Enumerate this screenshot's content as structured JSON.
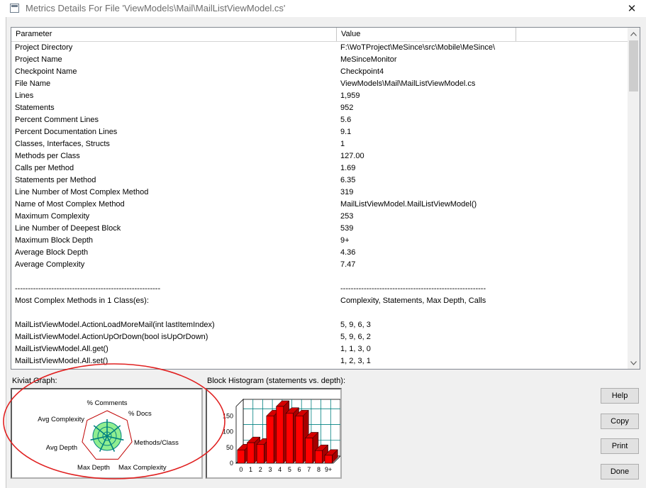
{
  "window": {
    "title": "Metrics Details For File 'ViewModels\\Mail\\MailListViewModel.cs'",
    "close_glyph": "✕"
  },
  "table": {
    "headers": [
      "Parameter",
      "Value"
    ],
    "rows": [
      {
        "param": "Project Directory",
        "value": "F:\\WoTProject\\MeSince\\src\\Mobile\\MeSince\\"
      },
      {
        "param": "Project Name",
        "value": "MeSinceMonitor"
      },
      {
        "param": "Checkpoint Name",
        "value": "Checkpoint4"
      },
      {
        "param": "File Name",
        "value": "ViewModels\\Mail\\MailListViewModel.cs"
      },
      {
        "param": "Lines",
        "value": "1,959"
      },
      {
        "param": "Statements",
        "value": "952"
      },
      {
        "param": "Percent Comment Lines",
        "value": "5.6"
      },
      {
        "param": "Percent Documentation Lines",
        "value": "9.1"
      },
      {
        "param": "Classes, Interfaces, Structs",
        "value": "1"
      },
      {
        "param": "Methods per Class",
        "value": "127.00"
      },
      {
        "param": "Calls per Method",
        "value": "1.69"
      },
      {
        "param": "Statements per Method",
        "value": "6.35"
      },
      {
        "param": "Line Number of Most Complex Method",
        "value": "319"
      },
      {
        "param": "Name of Most Complex Method",
        "value": "MailListViewModel.MailListViewModel()"
      },
      {
        "param": "Maximum Complexity",
        "value": "253"
      },
      {
        "param": "Line Number of Deepest Block",
        "value": "539"
      },
      {
        "param": "Maximum Block Depth",
        "value": "9+"
      },
      {
        "param": "Average Block Depth",
        "value": "4.36"
      },
      {
        "param": "Average Complexity",
        "value": "7.47"
      },
      {
        "param": "",
        "value": ""
      },
      {
        "param": "--------------------------------------------------------",
        "value": "--------------------------------------------------------"
      },
      {
        "param": "Most Complex Methods in 1 Class(es):",
        "value": "Complexity, Statements, Max Depth, Calls"
      },
      {
        "param": "",
        "value": ""
      },
      {
        "param": "MailListViewModel.ActionLoadMoreMail(int lastItemIndex)",
        "value": "5, 9, 6, 3"
      },
      {
        "param": "MailListViewModel.ActionUpOrDown(bool isUpOrDown)",
        "value": "5, 9, 6, 2"
      },
      {
        "param": "MailListViewModel.All.get()",
        "value": "1, 1, 3, 0"
      },
      {
        "param": "MailListViewModel.All.set()",
        "value": "1, 2, 3, 1"
      }
    ]
  },
  "kiviat": {
    "label": "Kiviat Graph:",
    "axes": [
      "% Comments",
      "% Docs",
      "Methods/Class",
      "Max Complexity",
      "Max Depth",
      "Avg Depth",
      "Avg Complexity"
    ]
  },
  "histogram": {
    "label": "Block Histogram (statements vs. depth):",
    "y_ticks": [
      "150",
      "100",
      "50",
      "0"
    ],
    "x_ticks": [
      "0",
      "1",
      "2",
      "3",
      "4",
      "5",
      "6",
      "7",
      "8",
      "9+"
    ],
    "colors": {
      "bar_front": "#ff0000",
      "bar_side": "#a50000",
      "bar_top": "#d40000",
      "grid": "#008080"
    }
  },
  "chart_data": {
    "type": "bar",
    "categories": [
      "0",
      "1",
      "2",
      "3",
      "4",
      "5",
      "6",
      "7",
      "8",
      "9+"
    ],
    "values": [
      42,
      65,
      60,
      150,
      180,
      158,
      150,
      80,
      40,
      25
    ],
    "title": "Block Histogram (statements vs. depth):",
    "xlabel": "",
    "ylabel": "",
    "ylim": [
      0,
      180
    ]
  },
  "buttons": {
    "help": "Help",
    "copy": "Copy",
    "print": "Print",
    "done": "Done"
  },
  "colors": {
    "annotation": "#e02020",
    "kiviat_fill": "#90ee90",
    "kiviat_spoke": "#008080"
  }
}
